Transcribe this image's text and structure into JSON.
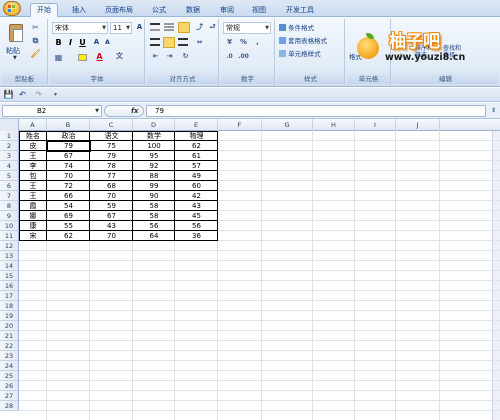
{
  "ribbon": {
    "tabs": [
      "开始",
      "插入",
      "页面布局",
      "公式",
      "数据",
      "审阅",
      "视图",
      "开发工具"
    ],
    "active_tab": 0,
    "clipboard": {
      "paste_label": "粘贴",
      "group_label": "剪贴板"
    },
    "font": {
      "font_name": "宋体",
      "font_size": "11",
      "group_label": "字体"
    },
    "alignment": {
      "group_label": "对齐方式"
    },
    "number": {
      "format": "常规",
      "group_label": "数字"
    },
    "styles": {
      "conditional": "条件格式",
      "table_format": "套用表格格式",
      "cell_styles": "单元格样式",
      "group_label": "样式"
    },
    "cells": {
      "format_label": "格式",
      "group_label": "单元格"
    },
    "editing": {
      "sort_filter": "排序和",
      "filter": "筛选",
      "find": "查找和",
      "select": "选择",
      "group_label": "编辑"
    },
    "watermark": {
      "title": "柚子吧",
      "url": "www.youzi8.cn"
    }
  },
  "formula_bar": {
    "name_box": "B2",
    "fx_label": "fx",
    "content": "79"
  },
  "sheet": {
    "columns": [
      "A",
      "B",
      "C",
      "D",
      "E",
      "F",
      "G",
      "H",
      "I",
      "J"
    ],
    "rows": [
      "1",
      "2",
      "3",
      "4",
      "5",
      "6",
      "7",
      "8",
      "9",
      "10",
      "11",
      "12",
      "13",
      "14",
      "15",
      "16",
      "17",
      "18",
      "19",
      "20",
      "21",
      "22",
      "23",
      "24",
      "25",
      "26",
      "27",
      "28"
    ],
    "headers": [
      "姓名",
      "政治",
      "语文",
      "数学",
      "物理"
    ],
    "data": [
      [
        "皮",
        "79",
        "75",
        "100",
        "62"
      ],
      [
        "王",
        "67",
        "79",
        "95",
        "61"
      ],
      [
        "李",
        "74",
        "78",
        "92",
        "57"
      ],
      [
        "包",
        "70",
        "77",
        "88",
        "49"
      ],
      [
        "王",
        "72",
        "68",
        "99",
        "60"
      ],
      [
        "王",
        "66",
        "70",
        "90",
        "42"
      ],
      [
        "霞",
        "54",
        "59",
        "58",
        "43"
      ],
      [
        "娜",
        "69",
        "67",
        "58",
        "45"
      ],
      [
        "康",
        "55",
        "43",
        "56",
        "56"
      ],
      [
        "宋",
        "62",
        "70",
        "64",
        "36"
      ]
    ]
  }
}
